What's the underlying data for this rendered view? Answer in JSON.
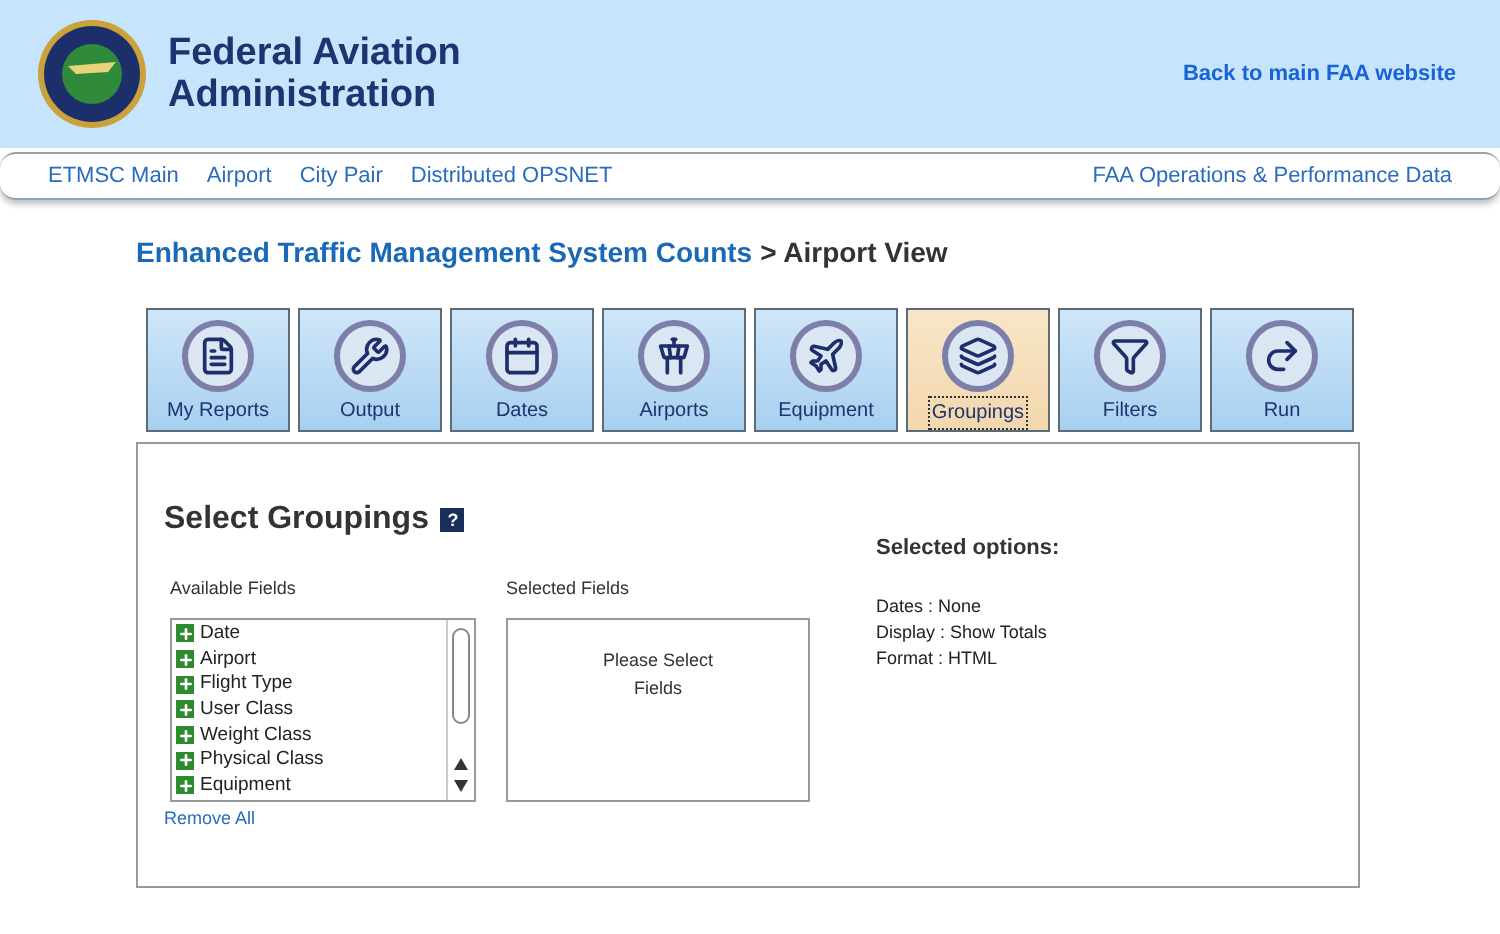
{
  "header": {
    "title_line_1": "Federal Aviation",
    "title_line_2": "Administration",
    "back_link": "Back to main FAA website"
  },
  "nav": {
    "items": [
      "ETMSC Main",
      "Airport",
      "City Pair",
      "Distributed OPSNET"
    ],
    "right_link": "FAA Operations & Performance Data"
  },
  "page_title": {
    "main": "Enhanced Traffic Management System Counts",
    "sub": "> Airport View"
  },
  "tabs": [
    {
      "label": "My Reports",
      "kind": "reports",
      "selected": false
    },
    {
      "label": "Output",
      "kind": "output",
      "selected": false
    },
    {
      "label": "Dates",
      "kind": "dates",
      "selected": false
    },
    {
      "label": "Airports",
      "kind": "airports",
      "selected": false
    },
    {
      "label": "Equipment",
      "kind": "equipment",
      "selected": false
    },
    {
      "label": "Groupings",
      "kind": "groupings",
      "selected": true
    },
    {
      "label": "Filters",
      "kind": "filters",
      "selected": false
    },
    {
      "label": "Run",
      "kind": "run",
      "selected": false
    }
  ],
  "panel": {
    "heading": "Select Groupings",
    "help": "?",
    "available_label": "Available Fields",
    "available_fields": [
      "Date",
      "Airport",
      "Flight Type",
      "User Class",
      "Weight Class",
      "Physical Class",
      "Equipment"
    ],
    "remove_all": "Remove All",
    "selected_label": "Selected Fields",
    "selected_placeholder": "Please Select Fields",
    "options_heading": "Selected options:",
    "options": [
      "Dates : None",
      "Display : Show Totals",
      "Format : HTML"
    ]
  }
}
